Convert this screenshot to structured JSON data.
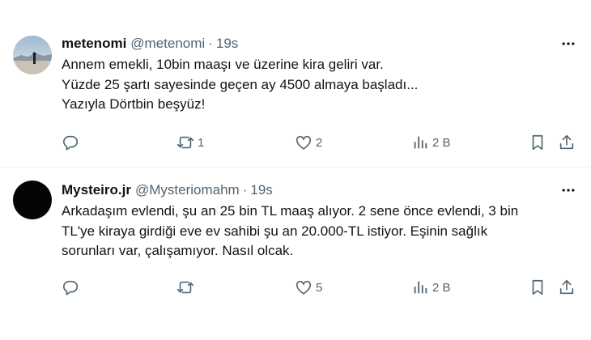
{
  "tweets": [
    {
      "name": "metenomi",
      "handle": "@metenomi",
      "separator": "·",
      "time": "19s",
      "lines": [
        "Annem emekli, 10bin maaşı ve üzerine kira geliri var.",
        "Yüzde 25 şartı sayesinde geçen ay 4500 almaya başladı...",
        "Yazıyla Dörtbin beşyüz!"
      ],
      "reply_count": "",
      "retweet_count": "1",
      "like_count": "2",
      "view_count": "2 B"
    },
    {
      "name": "Mysteiro.jr",
      "handle": "@Mysteriomahm",
      "separator": "·",
      "time": "19s",
      "lines": [
        "Arkadaşım evlendi, şu an 25 bin TL maaş alıyor. 2 sene önce evlendi, 3 bin",
        "TL'ye kiraya girdiği eve ev sahibi şu an 20.000-TL istiyor. Eşinin sağlık",
        "sorunları var, çalışamıyor.  Nasıl olcak."
      ],
      "reply_count": "",
      "retweet_count": "",
      "like_count": "5",
      "view_count": "2 B"
    }
  ],
  "icons": {
    "reply": "reply-icon",
    "retweet": "retweet-icon",
    "like": "heart-icon",
    "views": "views-icon",
    "bookmark": "bookmark-icon",
    "share": "share-icon",
    "more": "more-icon"
  },
  "colors": {
    "text": "#0f1419",
    "secondary": "#536471",
    "divider": "#eff3f4"
  }
}
